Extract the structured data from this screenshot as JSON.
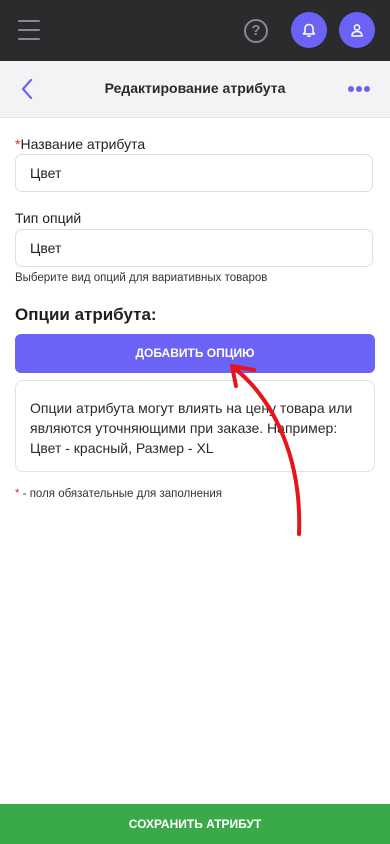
{
  "topbar": {
    "icons": {
      "menu": "hamburger-menu-icon",
      "help": "question-circle-icon",
      "bell": "bell-icon",
      "user": "user-icon"
    },
    "help_glyph": "?",
    "accent_color": "#6b63f5",
    "background_color": "#2b2b2e"
  },
  "header": {
    "title": "Редактирование атрибута",
    "back_icon": "chevron-left-icon",
    "more_icon": "more-dots-icon"
  },
  "form": {
    "name_field": {
      "required_mark": "*",
      "label": "Название атрибута",
      "value": "Цвет"
    },
    "type_field": {
      "label": "Тип опций",
      "value": "Цвет",
      "hint": "Выберите вид опций для вариативных товаров"
    },
    "options_section": {
      "title": "Опции атрибута:",
      "add_button": "ДОБАВИТЬ ОПЦИЮ",
      "info_text": "Опции атрибута могут влиять на цену товара или являются уточняющими при заказе. Например: Цвет - красный, Размер - XL"
    },
    "required_note": {
      "mark": "*",
      "text": " - поля обязательные для заполнения"
    }
  },
  "footer": {
    "save_button": "СОХРАНИТЬ АТРИБУТ",
    "color": "#3aa94a"
  },
  "annotation": {
    "arrow_color": "#e8141c"
  }
}
